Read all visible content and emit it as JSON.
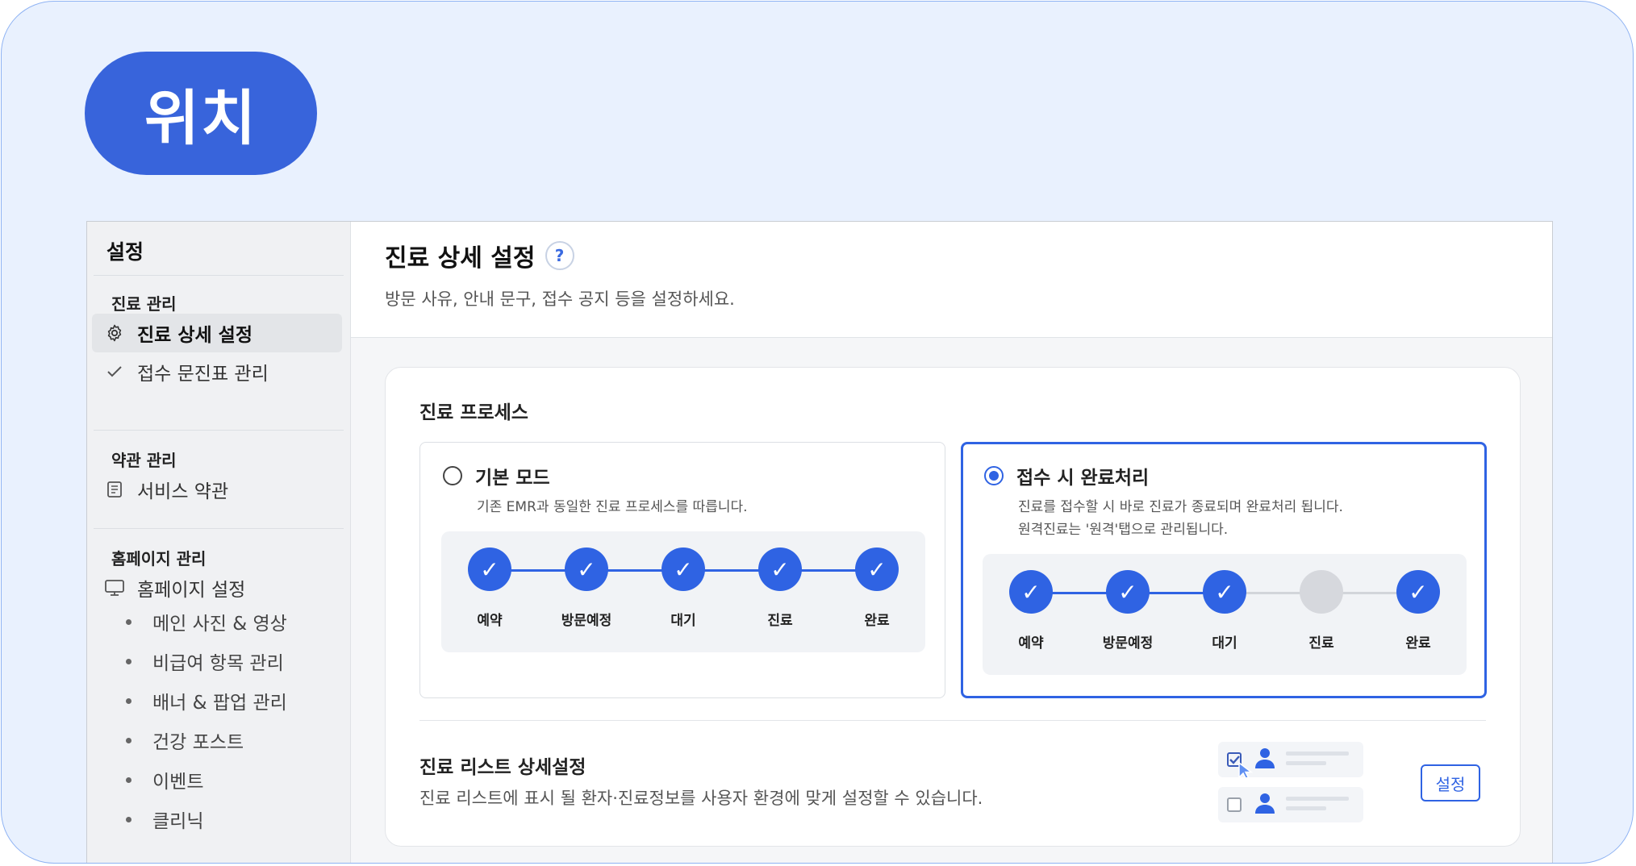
{
  "badge": "위치",
  "sidebar": {
    "title": "설정",
    "sections": [
      {
        "label": "진료 관리",
        "items": [
          {
            "label": "진료 상세 설정",
            "icon": "gear-icon",
            "active": true
          },
          {
            "label": "접수 문진표 관리",
            "icon": "check-icon",
            "active": false
          }
        ]
      },
      {
        "label": "약관 관리",
        "items": [
          {
            "label": "서비스 약관",
            "icon": "document-icon",
            "active": false
          }
        ]
      },
      {
        "label": "홈페이지 관리",
        "items": [
          {
            "label": "홈페이지 설정",
            "icon": "monitor-icon",
            "active": false
          }
        ],
        "subitems": [
          "메인 사진 & 영상",
          "비급여 항목 관리",
          "배너 & 팝업 관리",
          "건강 포스트",
          "이벤트",
          "클리닉"
        ]
      }
    ]
  },
  "main": {
    "title": "진료 상세 설정",
    "help_icon": "?",
    "description": "방문 사유, 안내 문구, 접수 공지 등을 설정하세요.",
    "process": {
      "title": "진료 프로세스",
      "modes": [
        {
          "label": "기본 모드",
          "selected": false,
          "desc": [
            "기존 EMR과 동일한 진료 프로세스를 따릅니다."
          ],
          "steps": [
            {
              "label": "예약",
              "done": true
            },
            {
              "label": "방문예정",
              "done": true
            },
            {
              "label": "대기",
              "done": true
            },
            {
              "label": "진료",
              "done": true
            },
            {
              "label": "완료",
              "done": true
            }
          ]
        },
        {
          "label": "접수 시 완료처리",
          "selected": true,
          "desc": [
            "진료를 접수할 시 바로 진료가 종료되며 완료처리 됩니다.",
            "원격진료는 '원격'탭으로 관리됩니다."
          ],
          "steps": [
            {
              "label": "예약",
              "done": true
            },
            {
              "label": "방문예정",
              "done": true
            },
            {
              "label": "대기",
              "done": true
            },
            {
              "label": "진료",
              "done": false
            },
            {
              "label": "완료",
              "done": true
            }
          ]
        }
      ]
    },
    "list_settings": {
      "title": "진료 리스트 상세설정",
      "description": "진료 리스트에 표시 될 환자·진료정보를 사용자 환경에 맞게 설정할 수 있습니다.",
      "button": "설정"
    }
  },
  "colors": {
    "accent": "#2f63e3",
    "badge_bg": "#3864db",
    "frame_bg": "#e9f1fe"
  }
}
